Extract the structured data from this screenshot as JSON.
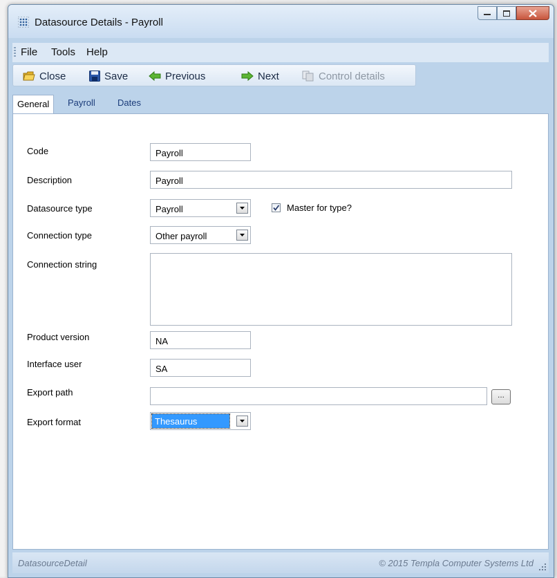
{
  "window": {
    "title": "Datasource Details - Payroll"
  },
  "menu": [
    "File",
    "Tools",
    "Help"
  ],
  "toolbar": {
    "close": "Close",
    "save": "Save",
    "previous": "Previous",
    "next": "Next",
    "control_details": "Control details"
  },
  "tabs": [
    "General",
    "Payroll",
    "Dates"
  ],
  "form": {
    "code": {
      "label": "Code",
      "value": "Payroll"
    },
    "description": {
      "label": "Description",
      "value": "Payroll"
    },
    "datasource_type": {
      "label": "Datasource type",
      "value": "Payroll"
    },
    "master_for_type": {
      "label": "Master for type?",
      "checked": true
    },
    "connection_type": {
      "label": "Connection type",
      "value": "Other payroll"
    },
    "connection_string": {
      "label": "Connection string",
      "value": ""
    },
    "product_version": {
      "label": "Product version",
      "value": "NA"
    },
    "interface_user": {
      "label": "Interface user",
      "value": "SA"
    },
    "export_path": {
      "label": "Export path",
      "value": "",
      "browse": "..."
    },
    "export_format": {
      "label": "Export format",
      "value": "Thesaurus"
    }
  },
  "status": {
    "left": "DatasourceDetail",
    "right": "© 2015 Templa Computer Systems Ltd"
  },
  "icons": [
    "app-grid-icon",
    "minimize-icon",
    "maximize-icon",
    "close-icon",
    "close-folder-icon",
    "save-disk-icon",
    "previous-arrow-icon",
    "next-arrow-icon",
    "control-details-icon",
    "checkmark-icon",
    "dropdown-arrow-icon",
    "size-grip-icon"
  ]
}
